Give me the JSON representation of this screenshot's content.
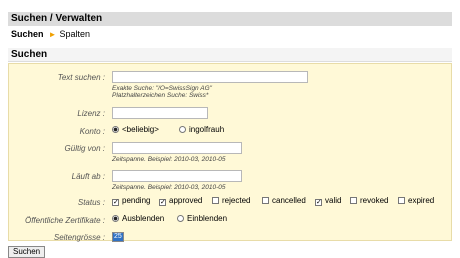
{
  "header": {
    "title": "Suchen / Verwalten"
  },
  "tabs": {
    "active": "Suchen",
    "other": "Spalten",
    "sep": "►"
  },
  "section": {
    "title": "Suchen"
  },
  "form": {
    "text_search": {
      "label": "Text suchen :",
      "value": "",
      "hint1": "Exakte Suche: \"/O=SwissSign AG\"",
      "hint2": "Platzhalterzeichen Suche: Swiss*"
    },
    "lizenz": {
      "label": "Lizenz :",
      "value": ""
    },
    "konto": {
      "label": "Konto :",
      "opt1": "<beliebig>",
      "opt2": "ingolfrauh",
      "selected": "<beliebig>"
    },
    "gueltig_von": {
      "label": "Gültig von :",
      "value": "",
      "hint": "Zeitspanne. Beispiel: 2010-03, 2010-05"
    },
    "laeuft_ab": {
      "label": "Läuft ab :",
      "value": "",
      "hint": "Zeitspanne. Beispiel: 2010-03, 2010-05"
    },
    "status": {
      "label": "Status :",
      "options": [
        {
          "label": "pending",
          "checked": true
        },
        {
          "label": "approved",
          "checked": true
        },
        {
          "label": "rejected",
          "checked": false
        },
        {
          "label": "cancelled",
          "checked": false
        },
        {
          "label": "valid",
          "checked": true
        },
        {
          "label": "revoked",
          "checked": false
        },
        {
          "label": "expired",
          "checked": false
        }
      ]
    },
    "oeffentliche": {
      "label": "Öffentliche Zertifikate :",
      "opt1": "Ausblenden",
      "opt2": "Einblenden",
      "selected": "Ausblenden"
    },
    "seitengroesse": {
      "label": "Seitengrösse :",
      "value": "25"
    }
  },
  "submit_label": "Suchen"
}
